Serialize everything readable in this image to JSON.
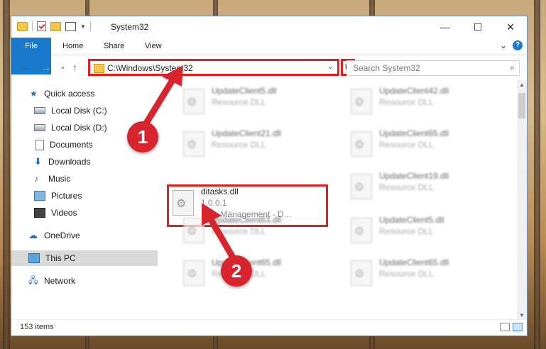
{
  "window": {
    "title": "System32"
  },
  "title_buttons": {
    "minimize": "—",
    "maximize": "☐",
    "close": "✕"
  },
  "ribbon": {
    "tabs": [
      "File",
      "Home",
      "Share",
      "View"
    ],
    "expand_caret": "⌄",
    "help": "?"
  },
  "address_bar": {
    "path": "C:\\Windows\\System32",
    "dropdown": "⌄",
    "refresh": "↻"
  },
  "nav_buttons": {
    "back": "←",
    "forward": "→",
    "recent": "⌄",
    "up": "↑"
  },
  "search": {
    "placeholder": "Search System32",
    "icon": "search-icon"
  },
  "sidebar": {
    "items": [
      {
        "label": "Quick access",
        "icon": "star-icon"
      },
      {
        "label": "Local Disk (C:)",
        "icon": "disk-icon",
        "pinned": true
      },
      {
        "label": "Local Disk (D:)",
        "icon": "disk-icon",
        "pinned": false
      },
      {
        "label": "Documents",
        "icon": "document-icon",
        "pinned": true
      },
      {
        "label": "Downloads",
        "icon": "download-icon",
        "pinned": true
      },
      {
        "label": "Music",
        "icon": "music-icon",
        "pinned": true
      },
      {
        "label": "Pictures",
        "icon": "pictures-icon",
        "pinned": true
      },
      {
        "label": "Videos",
        "icon": "videos-icon",
        "pinned": true
      },
      {
        "label": "OneDrive",
        "icon": "cloud-icon"
      },
      {
        "label": "This PC",
        "icon": "computer-icon",
        "selected": true
      },
      {
        "label": "Network",
        "icon": "network-icon"
      }
    ]
  },
  "files": [
    {
      "name": "UpdateClient5.dll",
      "desc": "Resource DLL"
    },
    {
      "name": "UpdateClient42.dll",
      "desc": "Resource DLL"
    },
    {
      "name": "UpdateClient21.dll",
      "desc": "Resource DLL"
    },
    {
      "name": "UpdateClient65.dll",
      "desc": "Resource DLL"
    },
    {
      "name": "ditasks.dll",
      "desc": "1.0.0.1",
      "desc2": "Diva Management - D..."
    },
    {
      "name": "UpdateClient19.dll",
      "desc": "Resource DLL"
    },
    {
      "name": "UpdateClient63.dll",
      "desc": "Resource DLL"
    },
    {
      "name": "UpdateClient5.dll",
      "desc": "Resource DLL"
    },
    {
      "name": "UpdateClient65.dll",
      "desc": "Resource DLL"
    },
    {
      "name": "UpdateClient65.dll",
      "desc": "Resource DLL"
    }
  ],
  "status": {
    "count": "153 items"
  },
  "markers": [
    "1",
    "2"
  ],
  "colors": {
    "accent": "#1979ca",
    "highlight": "#e02020"
  }
}
